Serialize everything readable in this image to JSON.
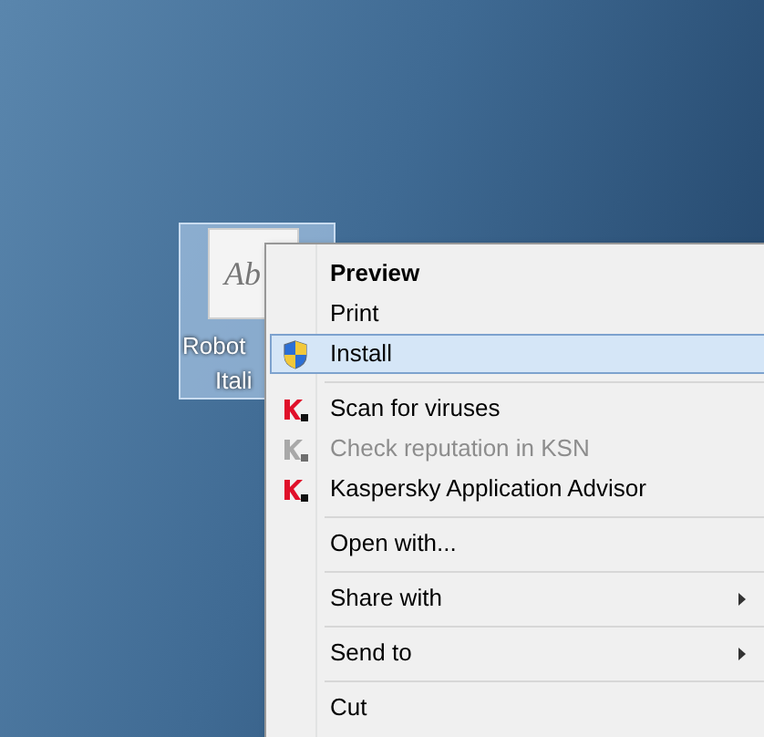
{
  "desktop_icon": {
    "preview_text": "Ab",
    "label_lines": [
      "Robot",
      "Itali"
    ],
    "selected": true
  },
  "context_menu": {
    "items": [
      {
        "kind": "default",
        "label": "Preview",
        "disabled": false,
        "selected": false
      },
      {
        "kind": "item",
        "label": "Print",
        "disabled": false,
        "selected": false
      },
      {
        "kind": "shield_item",
        "label": "Install",
        "disabled": false,
        "selected": true
      },
      {
        "kind": "separator"
      },
      {
        "kind": "k_item",
        "label": "Scan for viruses",
        "disabled": false,
        "selected": false
      },
      {
        "kind": "k_item",
        "label": "Check reputation in KSN",
        "disabled": true,
        "selected": false
      },
      {
        "kind": "k_item",
        "label": "Kaspersky Application Advisor",
        "disabled": false,
        "selected": false
      },
      {
        "kind": "separator"
      },
      {
        "kind": "item",
        "label": "Open with...",
        "disabled": false,
        "selected": false
      },
      {
        "kind": "separator"
      },
      {
        "kind": "submenu",
        "label": "Share with",
        "disabled": false,
        "selected": false
      },
      {
        "kind": "separator"
      },
      {
        "kind": "submenu",
        "label": "Send to",
        "disabled": false,
        "selected": false
      },
      {
        "kind": "separator"
      },
      {
        "kind": "item",
        "label": "Cut",
        "disabled": false,
        "selected": false
      }
    ]
  }
}
